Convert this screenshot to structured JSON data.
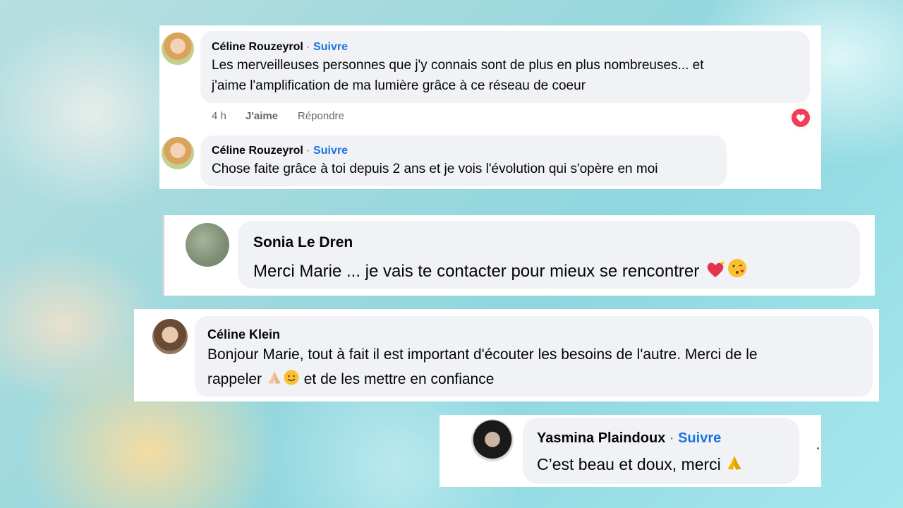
{
  "comments": [
    {
      "author": "Céline Rouzeyrol",
      "separator": "·",
      "follow": "Suivre",
      "text_line1": "Les merveilleuses personnes que j'y connais sont de plus en plus nombreuses... et",
      "text_line2": "j'aime l'amplification de ma lumière grâce à ce réseau de coeur",
      "time": "4 h",
      "like": "J'aime",
      "reply": "Répondre"
    },
    {
      "author": "Céline Rouzeyrol",
      "separator": "·",
      "follow": "Suivre",
      "text": "Chose faite grâce à toi depuis 2 ans et je vois l'évolution qui s'opère en moi"
    },
    {
      "author": "Sonia Le Dren",
      "text": "Merci Marie ... je vais te contacter pour mieux se rencontrer"
    },
    {
      "author": "Céline Klein",
      "text_line1": "Bonjour Marie, tout à fait il est important d'écouter les besoins de l'autre. Merci de le",
      "text_line2_a": "rappeler",
      "text_line2_b": "et de les mettre en confiance"
    },
    {
      "author": "Yasmina Plaindoux",
      "separator": "·",
      "follow": "Suivre",
      "text": "C’est beau et doux, merci"
    }
  ],
  "colors": {
    "link": "#1b74e4",
    "bubble": "#f0f2f5",
    "meta": "#65676b",
    "love_reaction": "#f33e58"
  },
  "icons": [
    "love-reaction-icon",
    "sparkling-heart-emoji",
    "kissing-face-emoji",
    "folded-hands-emoji",
    "smiling-face-emoji"
  ]
}
